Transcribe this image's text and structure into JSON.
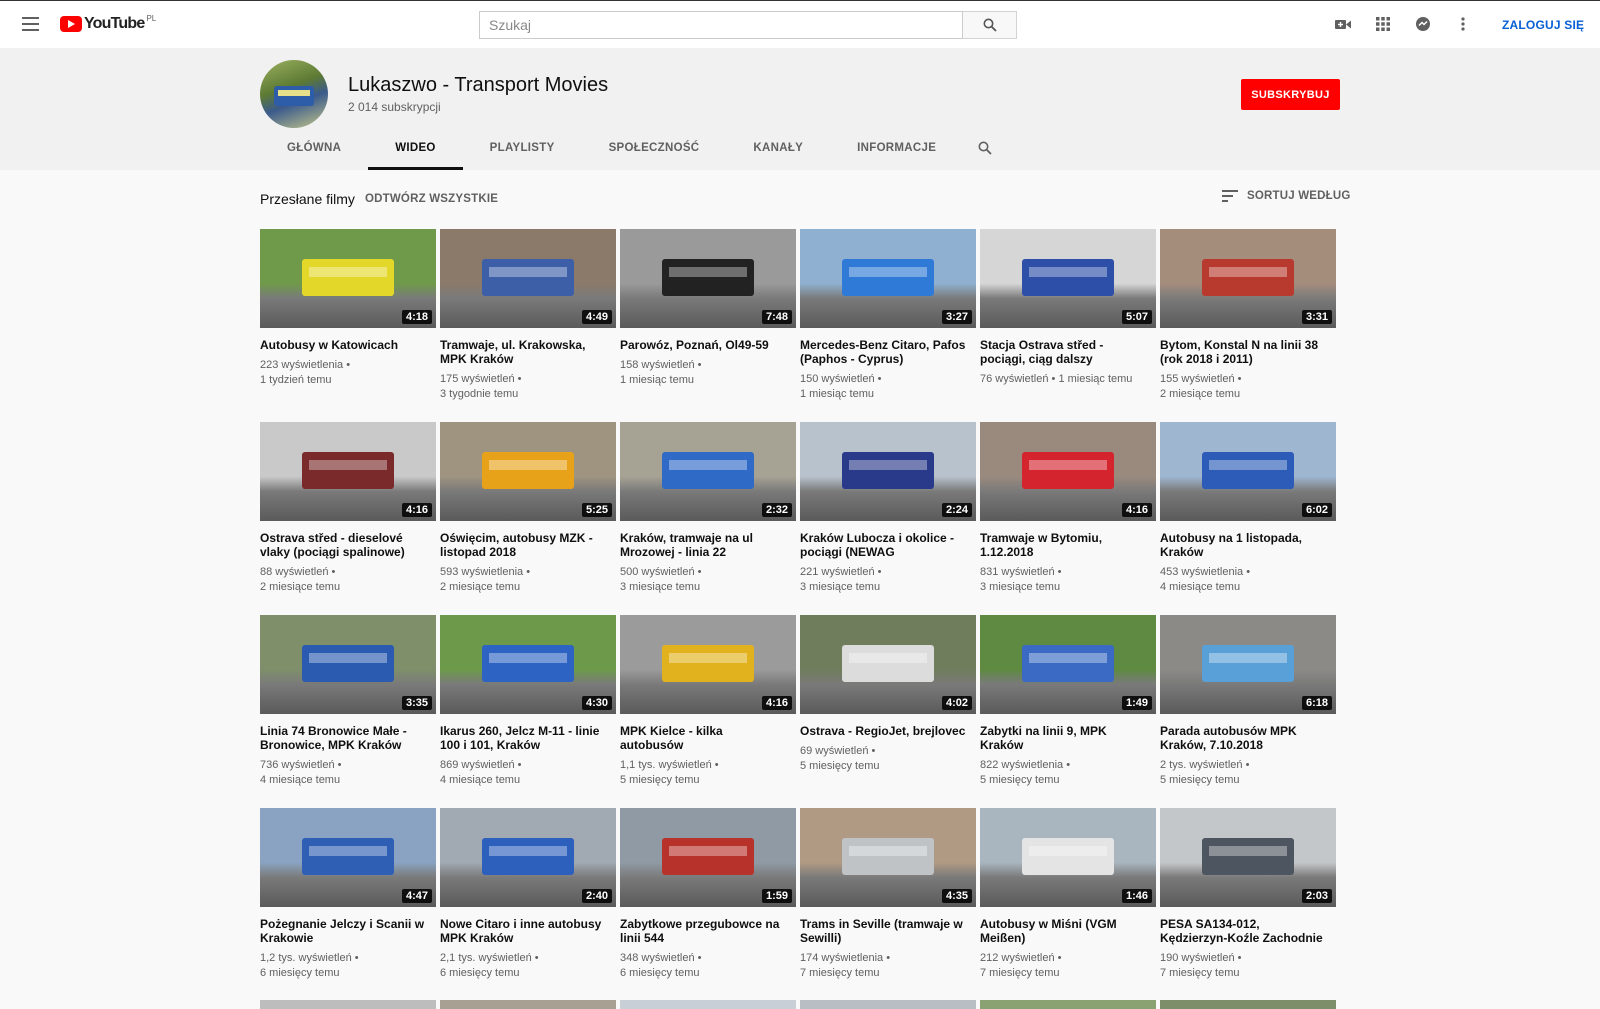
{
  "header": {
    "logo_text": "YouTube",
    "logo_country": "PL",
    "search_placeholder": "Szukaj",
    "signin_label": "ZALOGUJ SIĘ",
    "icons": [
      "video-camera-icon",
      "apps-grid-icon",
      "messages-icon",
      "more-vert-icon"
    ]
  },
  "channel": {
    "title": "Lukaszwo - Transport Movies",
    "subscribers": "2 014 subskrypcji",
    "subscribe_label": "SUBSKRYBUJ"
  },
  "tabs": [
    {
      "label": "GŁÓWNA",
      "active": false
    },
    {
      "label": "WIDEO",
      "active": true
    },
    {
      "label": "PLAYLISTY",
      "active": false
    },
    {
      "label": "SPOŁECZNOŚĆ",
      "active": false
    },
    {
      "label": "KANAŁY",
      "active": false
    },
    {
      "label": "INFORMACJE",
      "active": false
    }
  ],
  "section": {
    "title": "Przesłane filmy",
    "play_all": "ODTWÓRZ WSZYSTKIE",
    "sort_label": "SORTUJ WEDŁUG"
  },
  "videos": [
    {
      "title": "Autobusy w Katowicach",
      "duration": "4:18",
      "views": "223 wyświetlenia •",
      "age": "1 tydzień temu",
      "colors": [
        "#6e9a4a",
        "#e3d72a"
      ]
    },
    {
      "title": "Tramwaje, ul. Krakowska, MPK Kraków",
      "duration": "4:49",
      "views": "175 wyświetleń •",
      "age": "3 tygodnie temu",
      "colors": [
        "#8b7a6a",
        "#3c5fa8"
      ]
    },
    {
      "title": "Parowóz, Poznań, Ol49-59",
      "duration": "7:48",
      "views": "158 wyświetleń •",
      "age": "1 miesiąc temu",
      "colors": [
        "#9a9a9a",
        "#222222"
      ]
    },
    {
      "title": "Mercedes-Benz Citaro, Pafos (Paphos - Cyprus)",
      "duration": "3:27",
      "views": "150 wyświetleń •",
      "age": "1 miesiąc temu",
      "colors": [
        "#8fb0d0",
        "#2f7ad6"
      ]
    },
    {
      "title": "Stacja Ostrava střed - pociągi, ciąg dalszy",
      "duration": "5:07",
      "views": "76 wyświetleń • 1 miesiąc temu",
      "age": "",
      "colors": [
        "#d6d6d6",
        "#2d4fa8"
      ]
    },
    {
      "title": "Bytom, Konstal N na linii 38 (rok 2018 i 2011)",
      "duration": "3:31",
      "views": "155 wyświetleń •",
      "age": "2 miesiące temu",
      "colors": [
        "#a58d7c",
        "#b83a2f"
      ]
    },
    {
      "title": "Ostrava střed - dieselové vlaky (pociągi spalinowe)",
      "duration": "4:16",
      "views": "88 wyświetleń •",
      "age": "2 miesiące temu",
      "colors": [
        "#c9c9c9",
        "#7a2a2a"
      ]
    },
    {
      "title": "Oświęcim, autobusy MZK - listopad 2018",
      "duration": "5:25",
      "views": "593 wyświetlenia •",
      "age": "2 miesiące temu",
      "colors": [
        "#9e9480",
        "#e8a21a"
      ]
    },
    {
      "title": "Kraków, tramwaje na ul Mrozowej - linia 22",
      "duration": "2:32",
      "views": "500 wyświetleń •",
      "age": "3 miesiące temu",
      "colors": [
        "#a6a294",
        "#2f6bc6"
      ]
    },
    {
      "title": "Kraków Lubocza i okolice - pociągi (NEWAG",
      "duration": "2:24",
      "views": "221 wyświetleń •",
      "age": "3 miesiące temu",
      "colors": [
        "#b8c2cc",
        "#2a3a8a"
      ]
    },
    {
      "title": "Tramwaje w Bytomiu, 1.12.2018",
      "duration": "4:16",
      "views": "831 wyświetleń •",
      "age": "3 miesiące temu",
      "colors": [
        "#9a8a7e",
        "#d4242e"
      ]
    },
    {
      "title": "Autobusy na 1 listopada, Kraków",
      "duration": "6:02",
      "views": "453 wyświetlenia •",
      "age": "4 miesiące temu",
      "colors": [
        "#9fb6d1",
        "#2c5cb8"
      ]
    },
    {
      "title": "Linia 74 Bronowice Małe - Bronowice, MPK Kraków",
      "duration": "3:35",
      "views": "736 wyświetleń •",
      "age": "4 miesiące temu",
      "colors": [
        "#7e8f6a",
        "#2a5bb0"
      ]
    },
    {
      "title": "Ikarus 260, Jelcz M-11 - linie 100 i 101, Kraków",
      "duration": "4:30",
      "views": "869 wyświetleń •",
      "age": "4 miesiące temu",
      "colors": [
        "#6c9a4a",
        "#2d63c2"
      ]
    },
    {
      "title": "MPK Kielce - kilka autobusów",
      "duration": "4:16",
      "views": "1,1 tys. wyświetleń •",
      "age": "5 miesięcy temu",
      "colors": [
        "#9b9b9b",
        "#e2b21e"
      ]
    },
    {
      "title": "Ostrava - RegioJet, brejlovec",
      "duration": "4:02",
      "views": "69 wyświetleń •",
      "age": "5 miesięcy temu",
      "colors": [
        "#6f7d5c",
        "#dcdcdc"
      ]
    },
    {
      "title": "Zabytki na linii 9, MPK Kraków",
      "duration": "1:49",
      "views": "822 wyświetlenia •",
      "age": "5 miesięcy temu",
      "colors": [
        "#5f8a42",
        "#3a6ac4"
      ]
    },
    {
      "title": "Parada autobusów MPK Kraków, 7.10.2018",
      "duration": "6:18",
      "views": "2 tys. wyświetleń •",
      "age": "5 miesięcy temu",
      "colors": [
        "#8c8a86",
        "#5aa0d8"
      ]
    },
    {
      "title": "Pożegnanie Jelczy i Scanii w Krakowie",
      "duration": "4:47",
      "views": "1,2 tys. wyświetleń •",
      "age": "6 miesięcy temu",
      "colors": [
        "#8aa3c2",
        "#2e5fb4"
      ]
    },
    {
      "title": "Nowe Citaro i inne autobusy MPK Kraków",
      "duration": "2:40",
      "views": "2,1 tys. wyświetleń •",
      "age": "6 miesięcy temu",
      "colors": [
        "#a1a9b2",
        "#2d5fbd"
      ]
    },
    {
      "title": "Zabytkowe przegubowce na linii 544",
      "duration": "1:59",
      "views": "348 wyświetleń •",
      "age": "6 miesięcy temu",
      "colors": [
        "#8f9aa4",
        "#b8322c"
      ]
    },
    {
      "title": "Trams in Seville (tramwaje w Sewilli)",
      "duration": "4:35",
      "views": "174 wyświetlenia •",
      "age": "7 miesięcy temu",
      "colors": [
        "#b09a84",
        "#bfc3c6"
      ]
    },
    {
      "title": "Autobusy w Miśni (VGM Meißen)",
      "duration": "1:46",
      "views": "212 wyświetleń •",
      "age": "7 miesięcy temu",
      "colors": [
        "#a9b5bf",
        "#e4e4e4"
      ]
    },
    {
      "title": "PESA SA134-012, Kędzierzyn-Koźle Zachodnie",
      "duration": "2:03",
      "views": "190 wyświetleń •",
      "age": "7 miesięcy temu",
      "colors": [
        "#c4c7c9",
        "#4d5660"
      ]
    }
  ]
}
